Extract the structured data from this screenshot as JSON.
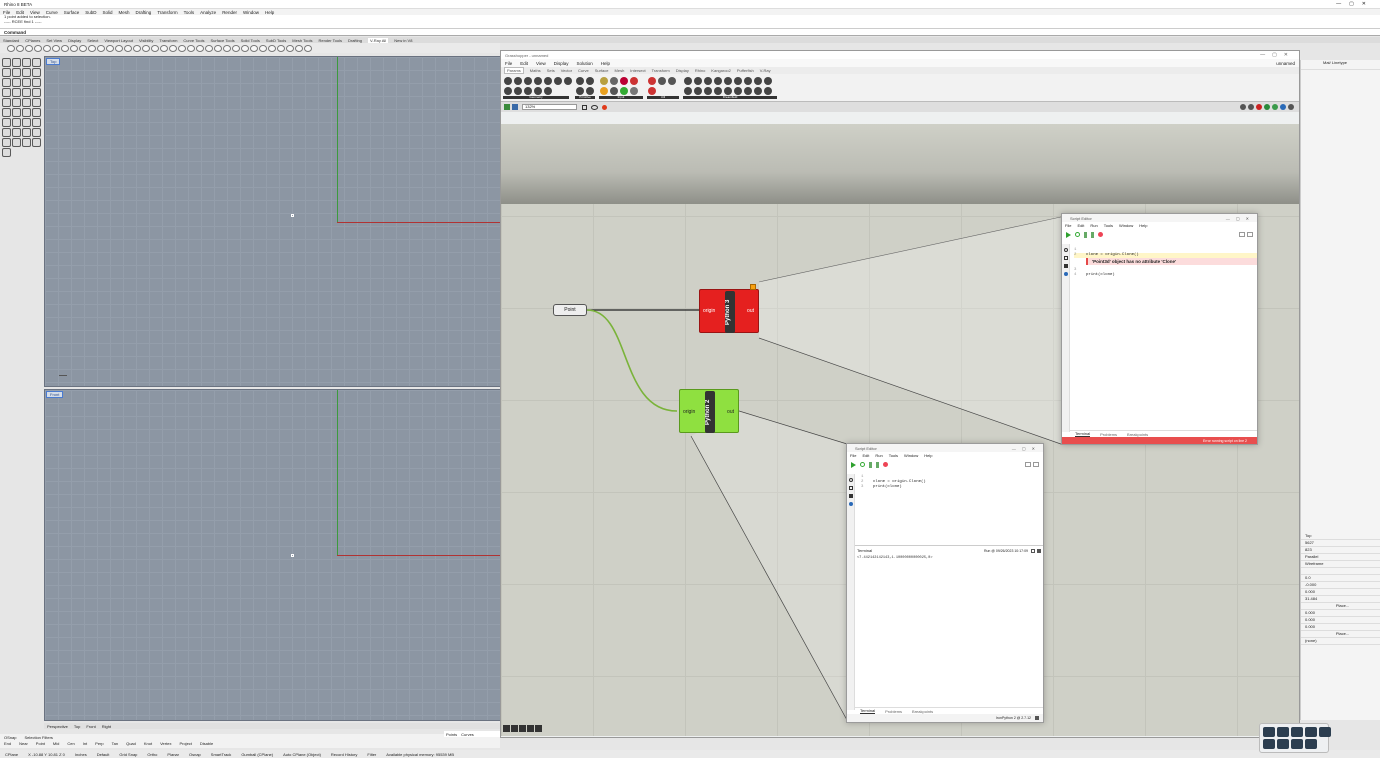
{
  "app": {
    "title": "Rhino 8 BETA",
    "menu": [
      "File",
      "Edit",
      "View",
      "Curve",
      "Surface",
      "SubD",
      "Solid",
      "Mesh",
      "Drafting",
      "Transform",
      "Tools",
      "Analyze",
      "Render",
      "Window",
      "Help"
    ]
  },
  "command": {
    "history": [
      "1 point added to selection.",
      "----- RCEE find 1 -----"
    ],
    "prompt": "Command"
  },
  "tabs": [
    "Standard",
    "CPlanes",
    "Set View",
    "Display",
    "Select",
    "Viewport Layout",
    "Visibility",
    "Transform",
    "Curve Tools",
    "Surface Tools",
    "Solid Tools",
    "SubD Tools",
    "Mesh Tools",
    "Render Tools",
    "Drafting",
    "V-Ray All",
    "New in V8"
  ],
  "active_tab": "V-Ray All",
  "viewports": {
    "top_label": "Top",
    "front_label": "Front"
  },
  "viewport_tabs": [
    "Perspective",
    "Top",
    "Front",
    "Right"
  ],
  "osnap": {
    "tabs": [
      "OSnap",
      "Selection Filters"
    ],
    "items": [
      "End",
      "Near",
      "Point",
      "Mid",
      "Cen",
      "Int",
      "Perp",
      "Tan",
      "Quad",
      "Knot",
      "Vertex",
      "Project",
      "Disable"
    ],
    "filters": [
      "Points",
      "Curves"
    ]
  },
  "status": {
    "cplane": "CPlane",
    "coords": "X -10.88 Y 10.81 Z 0",
    "units": "Inches",
    "layer": "Default",
    "items": [
      "Grid Snap",
      "Ortho",
      "Planar",
      "Osnap",
      "SmartTrack",
      "Gumball (CPlane)",
      "Auto CPlane (Object)",
      "Record History",
      "Filter",
      "Available physical memory: 95539 MB"
    ]
  },
  "grasshopper": {
    "title": "Grasshopper - unnamed",
    "doc": "unnamed",
    "menu": [
      "File",
      "Edit",
      "View",
      "Display",
      "Solution",
      "Help"
    ],
    "tabs": [
      "Params",
      "Maths",
      "Sets",
      "Vector",
      "Curve",
      "Surface",
      "Mesh",
      "Intersect",
      "Transform",
      "Display",
      "Rhino",
      "Kangaroo2",
      "Pufferfish",
      "V-Ray"
    ],
    "active_tab": "Params",
    "ribbon_groups": [
      "Geometry",
      "Primitive",
      "Input",
      "Util",
      "Dreamfield"
    ],
    "zoom": "132%"
  },
  "nodes": {
    "point_label": "Point",
    "python3_label": "Python 3",
    "python2_label": "Python 2",
    "input": "origin",
    "output": "out"
  },
  "editor3": {
    "title": "Script Editor",
    "menu": [
      "File",
      "Edit",
      "Run",
      "Tools",
      "Window",
      "Help"
    ],
    "code": [
      "clone = origin.Clone()",
      "print(clone)"
    ],
    "line_nums": [
      "1",
      "2",
      "3",
      "4"
    ],
    "error": "'Point3d' object has no attribute 'Clone'",
    "tabs": [
      "Terminal",
      "Problems",
      "Breakpoints"
    ],
    "status": "Error running script on line 2"
  },
  "editor2": {
    "title": "Script Editor",
    "menu": [
      "File",
      "Edit",
      "Run",
      "Tools",
      "Window",
      "Help"
    ],
    "code": [
      "clone = origin.Clone()",
      "print(clone)"
    ],
    "line_nums": [
      "1",
      "2",
      "3"
    ],
    "terminal_label": "Terminal",
    "terminal_time": "Run @ 09/26/2023 10:17:09",
    "output": "<7.442142142143,1.10000000000025,0>",
    "tabs": [
      "Terminal",
      "Problems",
      "Breakpoints"
    ],
    "status": "IronPython 2 @ 2.7.12"
  },
  "rightpanel": {
    "header": "Mat/ Linetype",
    "props": [
      "Top",
      "5627",
      "823",
      "Parallel",
      "Wireframe",
      "",
      "0.0",
      "-0.000",
      "0.000",
      "31.484",
      "Place...",
      "0.000",
      "0.000",
      "0.000",
      "Place...",
      "(none)"
    ]
  }
}
